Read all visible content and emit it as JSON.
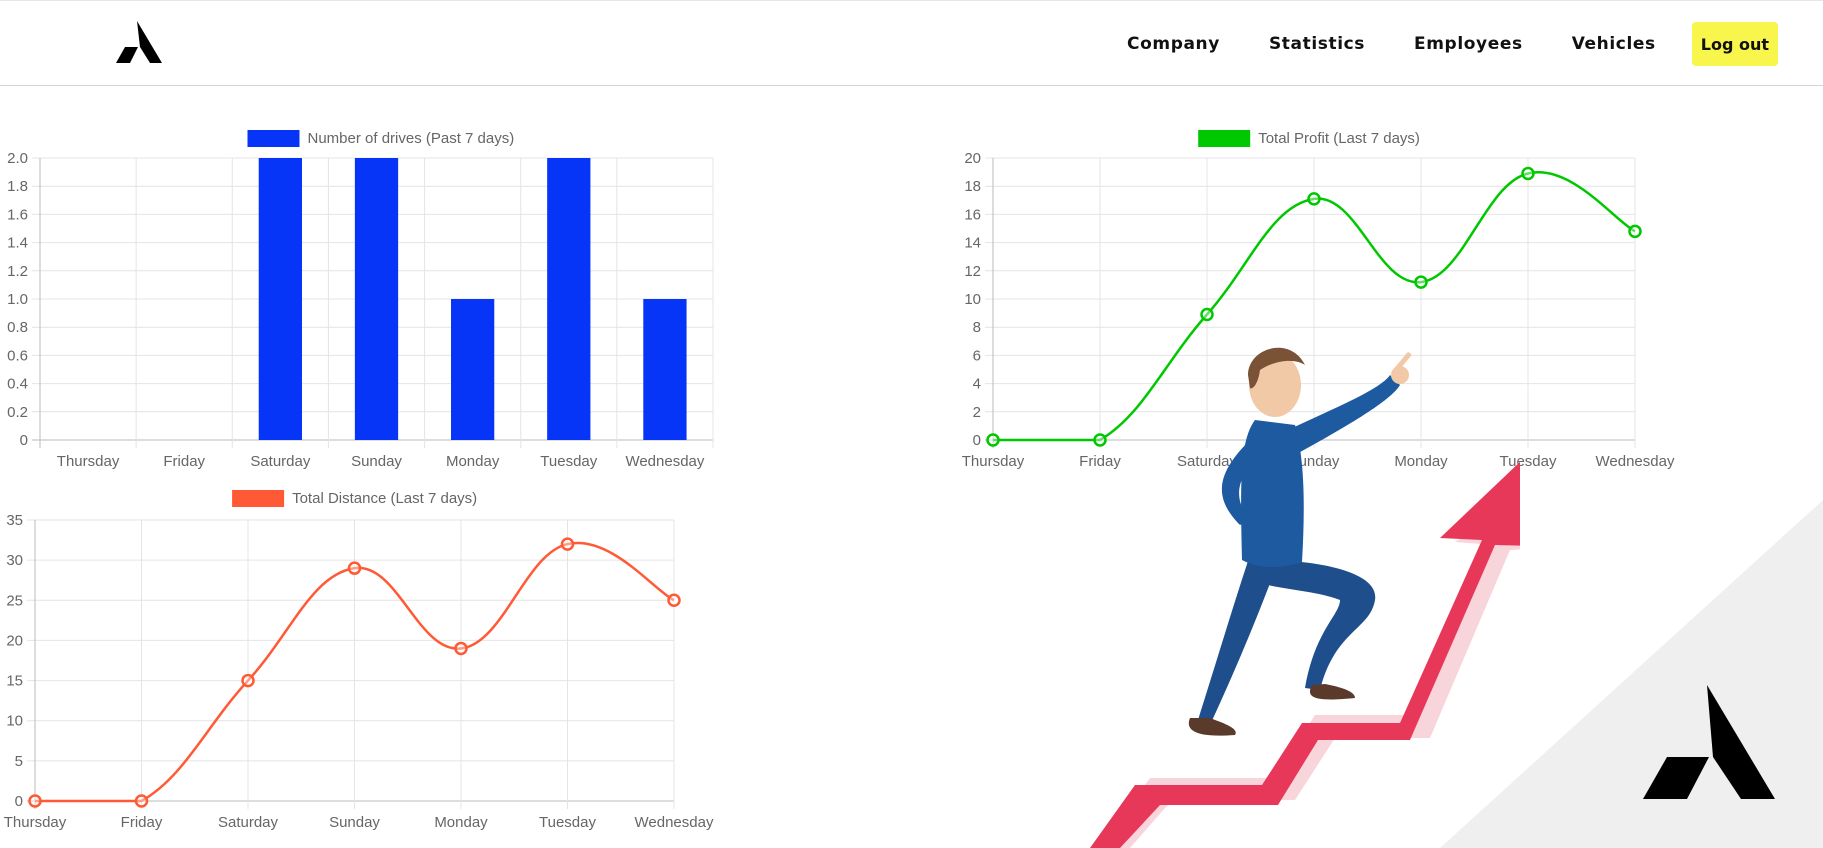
{
  "nav": {
    "links": [
      "Company",
      "Statistics",
      "Employees",
      "Vehicles"
    ],
    "logout_label": "Log out",
    "button_color": "#f8f54c"
  },
  "logo_icon": "stylized-a-logo-icon",
  "illustration": "cartoon-businessman-climbing-rising-arrow-illustration",
  "chart_data": [
    {
      "id": "drives",
      "type": "bar",
      "title": "Number of drives (Past 7 days)",
      "color": "#0635f7",
      "categories": [
        "Thursday",
        "Friday",
        "Saturday",
        "Sunday",
        "Monday",
        "Tuesday",
        "Wednesday"
      ],
      "series": [
        {
          "name": "Number of drives (Past 7 days)",
          "values": [
            0,
            0,
            2,
            2,
            1,
            2,
            1
          ]
        }
      ],
      "ylim": [
        0,
        2
      ],
      "yticks": [
        "0",
        "0.2",
        "0.4",
        "0.6",
        "0.8",
        "1.0",
        "1.2",
        "1.4",
        "1.6",
        "1.8",
        "2.0"
      ],
      "grid": true,
      "legend": "top"
    },
    {
      "id": "profit",
      "type": "line",
      "title": "Total Profit (Last 7 days)",
      "color": "#00c800",
      "categories": [
        "Thursday",
        "Friday",
        "Saturday",
        "Sunday",
        "Monday",
        "Tuesday",
        "Wednesday"
      ],
      "series": [
        {
          "name": "Total Profit (Last 7 days)",
          "values": [
            0,
            0,
            8.9,
            17.1,
            11.2,
            18.9,
            14.8
          ]
        }
      ],
      "ylim": [
        0,
        20
      ],
      "yticks": [
        "0",
        "2",
        "4",
        "6",
        "8",
        "10",
        "12",
        "14",
        "16",
        "18",
        "20"
      ],
      "grid": true,
      "legend": "top"
    },
    {
      "id": "distance",
      "type": "line",
      "title": "Total Distance (Last 7 days)",
      "color": "#ff5a35",
      "categories": [
        "Thursday",
        "Friday",
        "Saturday",
        "Sunday",
        "Monday",
        "Tuesday",
        "Wednesday"
      ],
      "series": [
        {
          "name": "Total Distance (Last 7 days)",
          "values": [
            0,
            0,
            15,
            29,
            19,
            32,
            25
          ]
        }
      ],
      "ylim": [
        0,
        35
      ],
      "yticks": [
        "0",
        "5",
        "10",
        "15",
        "20",
        "25",
        "30",
        "35"
      ],
      "grid": true,
      "legend": "top"
    }
  ]
}
